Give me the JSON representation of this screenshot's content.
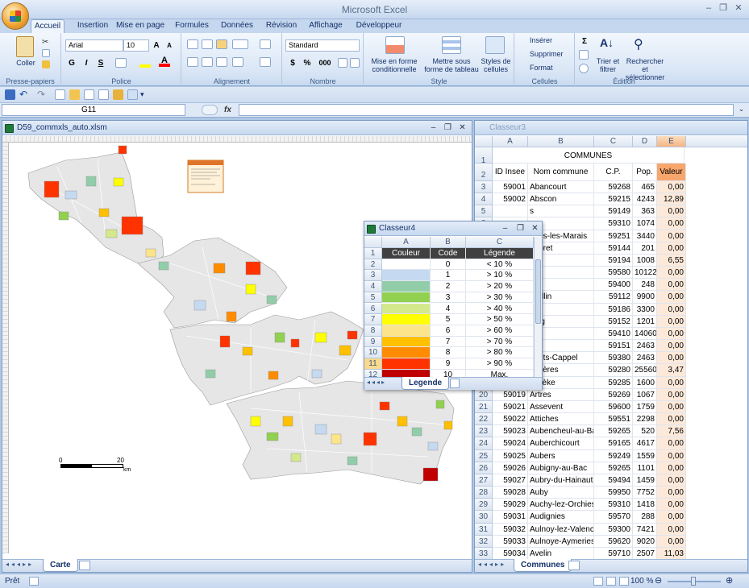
{
  "app_title": "Microsoft Excel",
  "tabs": [
    "Accueil",
    "Insertion",
    "Mise en page",
    "Formules",
    "Données",
    "Révision",
    "Affichage",
    "Développeur"
  ],
  "ribbon": {
    "clipboard": {
      "label": "Presse-papiers",
      "paste": "Coller"
    },
    "font": {
      "label": "Police",
      "font_name": "Arial",
      "font_size": "10",
      "bold": "G",
      "italic": "I",
      "underline": "S"
    },
    "alignment": {
      "label": "Alignement"
    },
    "number": {
      "label": "Nombre",
      "format": "Standard"
    },
    "style": {
      "label": "Style",
      "cond": "Mise en forme conditionnelle",
      "table": "Mettre sous forme de tableau",
      "cellstyles": "Styles de cellules"
    },
    "cells": {
      "label": "Cellules",
      "insert": "Insérer",
      "delete": "Supprimer",
      "format": "Format"
    },
    "editing": {
      "label": "Édition",
      "sort": "Trier et filtrer",
      "find": "Rechercher et sélectionner"
    }
  },
  "formula_bar": {
    "name_box": "G11",
    "fx": "fx",
    "value": ""
  },
  "map_window": {
    "title": "D59_commxls_auto.xlsm",
    "sheet_tab": "Carte",
    "scale_start": "0",
    "scale_end": "20",
    "scale_unit": "km"
  },
  "communes": {
    "title": "Classeur3",
    "sheet_tab": "Communes",
    "table_title": "COMMUNES",
    "col_letters": [
      "A",
      "B",
      "C",
      "D",
      "E"
    ],
    "headers": [
      "ID Insee",
      "Nom commune",
      "C.P.",
      "Pop.",
      "Valeur"
    ],
    "rows": [
      [
        "59001",
        "Abancourt",
        "59268",
        "465",
        "0,00"
      ],
      [
        "59002",
        "Abscon",
        "59215",
        "4243",
        "12,89"
      ],
      [
        "",
        "s",
        "59149",
        "363",
        "0,00"
      ],
      [
        "",
        "",
        "59310",
        "1074",
        "0,00"
      ],
      [
        "",
        "nnes-les-Marais",
        "59251",
        "3440",
        "0,00"
      ],
      [
        "",
        "roipret",
        "59144",
        "201",
        "0,00"
      ],
      [
        "",
        "ers",
        "59194",
        "1008",
        "6,55"
      ],
      [
        "",
        "he",
        "59580",
        "10122",
        "0,00"
      ],
      [
        "",
        "eux",
        "59400",
        "248",
        "0,00"
      ],
      [
        "",
        "œullin",
        "59112",
        "9900",
        "0,00"
      ],
      [
        "",
        "",
        "59186",
        "3300",
        "0,00"
      ],
      [
        "",
        "aing",
        "59152",
        "1201",
        "0,00"
      ],
      [
        "",
        "n",
        "59410",
        "14060",
        "0,00"
      ],
      [
        "",
        "ux",
        "59151",
        "2463",
        "0,00"
      ],
      [
        "",
        "bouts-Cappel",
        "59380",
        "2463",
        "0,00"
      ],
      [
        "",
        "entières",
        "59280",
        "25560",
        "3,47"
      ],
      [
        "59018",
        "Arrièke",
        "59285",
        "1600",
        "0,00"
      ],
      [
        "59019",
        "Artres",
        "59269",
        "1067",
        "0,00"
      ],
      [
        "59021",
        "Assevent",
        "59600",
        "1759",
        "0,00"
      ],
      [
        "59022",
        "Attiches",
        "59551",
        "2298",
        "0,00"
      ],
      [
        "59023",
        "Aubencheul-au-Bac",
        "59265",
        "520",
        "7,56"
      ],
      [
        "59024",
        "Auberchicourt",
        "59165",
        "4617",
        "0,00"
      ],
      [
        "59025",
        "Aubers",
        "59249",
        "1559",
        "0,00"
      ],
      [
        "59026",
        "Aubigny-au-Bac",
        "59265",
        "1101",
        "0,00"
      ],
      [
        "59027",
        "Aubry-du-Hainaut",
        "59494",
        "1459",
        "0,00"
      ],
      [
        "59028",
        "Auby",
        "59950",
        "7752",
        "0,00"
      ],
      [
        "59029",
        "Auchy-lez-Orchies",
        "59310",
        "1418",
        "0,00"
      ],
      [
        "59031",
        "Audignies",
        "59570",
        "288",
        "0,00"
      ],
      [
        "59032",
        "Aulnoy-lez-Valenciennes",
        "59300",
        "7421",
        "0,00"
      ],
      [
        "59033",
        "Aulnoye-Aymeries",
        "59620",
        "9020",
        "0,00"
      ],
      [
        "59034",
        "Avelin",
        "59710",
        "2507",
        "11,03"
      ]
    ]
  },
  "legend_window": {
    "title": "Classeur4",
    "sheet_tab": "Legende",
    "col_letters": [
      "A",
      "B",
      "C"
    ],
    "headers": [
      "Couleur",
      "Code",
      "Légende"
    ],
    "rows": [
      {
        "color": "#ffffff",
        "code": "0",
        "label": "< 10 %"
      },
      {
        "color": "#c5d9f1",
        "code": "1",
        "label": "> 10 %"
      },
      {
        "color": "#92cdaa",
        "code": "2",
        "label": "> 20 %"
      },
      {
        "color": "#92d050",
        "code": "3",
        "label": "> 30 %"
      },
      {
        "color": "#d4e88c",
        "code": "4",
        "label": "> 40 %"
      },
      {
        "color": "#ffff00",
        "code": "5",
        "label": "> 50 %"
      },
      {
        "color": "#fce48a",
        "code": "6",
        "label": "> 60 %"
      },
      {
        "color": "#ffc000",
        "code": "7",
        "label": "> 70 %"
      },
      {
        "color": "#ff8c00",
        "code": "8",
        "label": "> 80 %"
      },
      {
        "color": "#ff3300",
        "code": "9",
        "label": "> 90 %"
      },
      {
        "color": "#c00000",
        "code": "10",
        "label": "Max."
      }
    ]
  },
  "status": {
    "ready": "Prêt",
    "zoom": "100 %"
  }
}
